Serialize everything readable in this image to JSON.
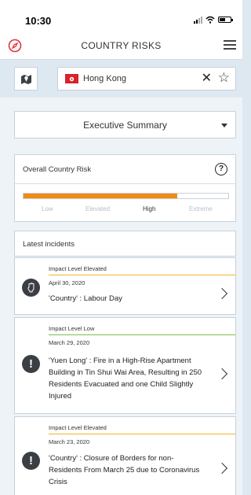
{
  "status": {
    "time": "10:30"
  },
  "header": {
    "title": "COUNTRY RISKS",
    "logo_icon": "compass-logo-icon",
    "menu_icon": "hamburger-menu-icon"
  },
  "search": {
    "country": "Hong Kong",
    "clear_icon": "clear-icon",
    "favorite_icon": "star-outline-icon",
    "map_icon": "map-icon"
  },
  "summary": {
    "selected": "Executive Summary"
  },
  "risk": {
    "title": "Overall Country Risk",
    "levels": [
      "Low",
      "Elevated",
      "High",
      "Extreme"
    ],
    "active_level": "High",
    "fill_fraction": 0.75,
    "color": "#ef8c16"
  },
  "incidents": {
    "title": "Latest incidents",
    "items": [
      {
        "impact": "Impact Level Elevated",
        "date": "April 30, 2020",
        "title": "'Country' : Labour Day",
        "icon": "raised-fist-icon",
        "line_color": "#f0b429"
      },
      {
        "impact": "Impact Level Low",
        "date": "March 29, 2020",
        "title": "'Yuen Long' : Fire in a High-Rise Apartment Building in Tin Shui Wai Area, Resulting in 250 Residents Evacuated and one Child Slightly Injured",
        "icon": "exclamation-icon",
        "line_color": "#7cc04b"
      },
      {
        "impact": "Impact Level Elevated",
        "date": "March 23, 2020",
        "title": "'Country' : Closure of Borders for non-Residents From March 25 due to Coronavirus Crisis",
        "icon": "exclamation-icon",
        "line_color": "#f0b429"
      }
    ]
  }
}
